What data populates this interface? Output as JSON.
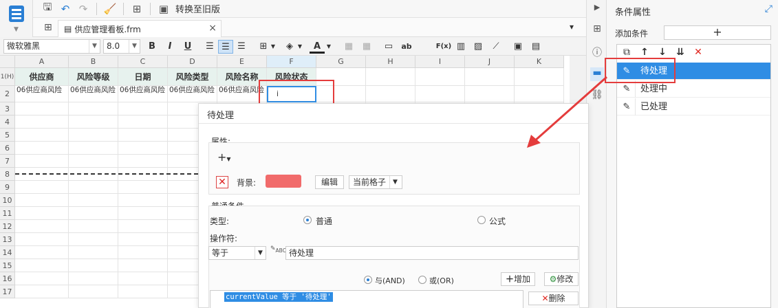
{
  "toolbar": {
    "convert_label": "转换至旧版"
  },
  "tab": {
    "title": "供应管理看板.frm"
  },
  "format": {
    "font_family": "微软雅黑",
    "font_size": "8.0",
    "bold": "B",
    "italic": "I",
    "underline": "U",
    "text_ab": "ab",
    "func": "F(x)"
  },
  "sheet": {
    "columns": [
      "A",
      "B",
      "C",
      "D",
      "E",
      "F",
      "G",
      "H",
      "I",
      "J",
      "K"
    ],
    "row_header_1": "1(H)",
    "rows": [
      "2",
      "3",
      "4",
      "5",
      "6",
      "7",
      "8",
      "9",
      "10",
      "11",
      "12",
      "13",
      "14",
      "15",
      "16",
      "17"
    ],
    "headers": [
      "供应商",
      "风险等级",
      "日期",
      "风险类型",
      "风险名称",
      "风险状态"
    ],
    "row2": [
      "06供应商风险",
      "06供应商风险",
      "06供应商风险",
      "06供应商风险",
      "06供应商风险",
      "i"
    ]
  },
  "panel": {
    "title": "条件属性",
    "add_label": "添加条件",
    "add_button": "+",
    "items": [
      "待处理",
      "处理中",
      "已处理"
    ]
  },
  "dialog": {
    "title": "待处理",
    "attr_section": "属性:",
    "add_attr": "+",
    "bg_label": "背景:",
    "bg_color": "#f16b6b",
    "edit_button": "编辑",
    "scope": "当前格子",
    "normal_cond": "普通条件",
    "type_label": "类型:",
    "type_normal": "普通",
    "type_formula": "公式",
    "operator_label": "操作符:",
    "operator": "等于",
    "value": "待处理",
    "and_label": "与(AND)",
    "or_label": "或(OR)",
    "add_button": "增加",
    "modify_button": "修改",
    "delete_button": "删除",
    "expression": "currentValue 等于 '待处理'"
  },
  "colors": {
    "accent": "#2f8de4",
    "highlight_red": "#e43c3c",
    "header_fill": "#e7f2ee"
  }
}
